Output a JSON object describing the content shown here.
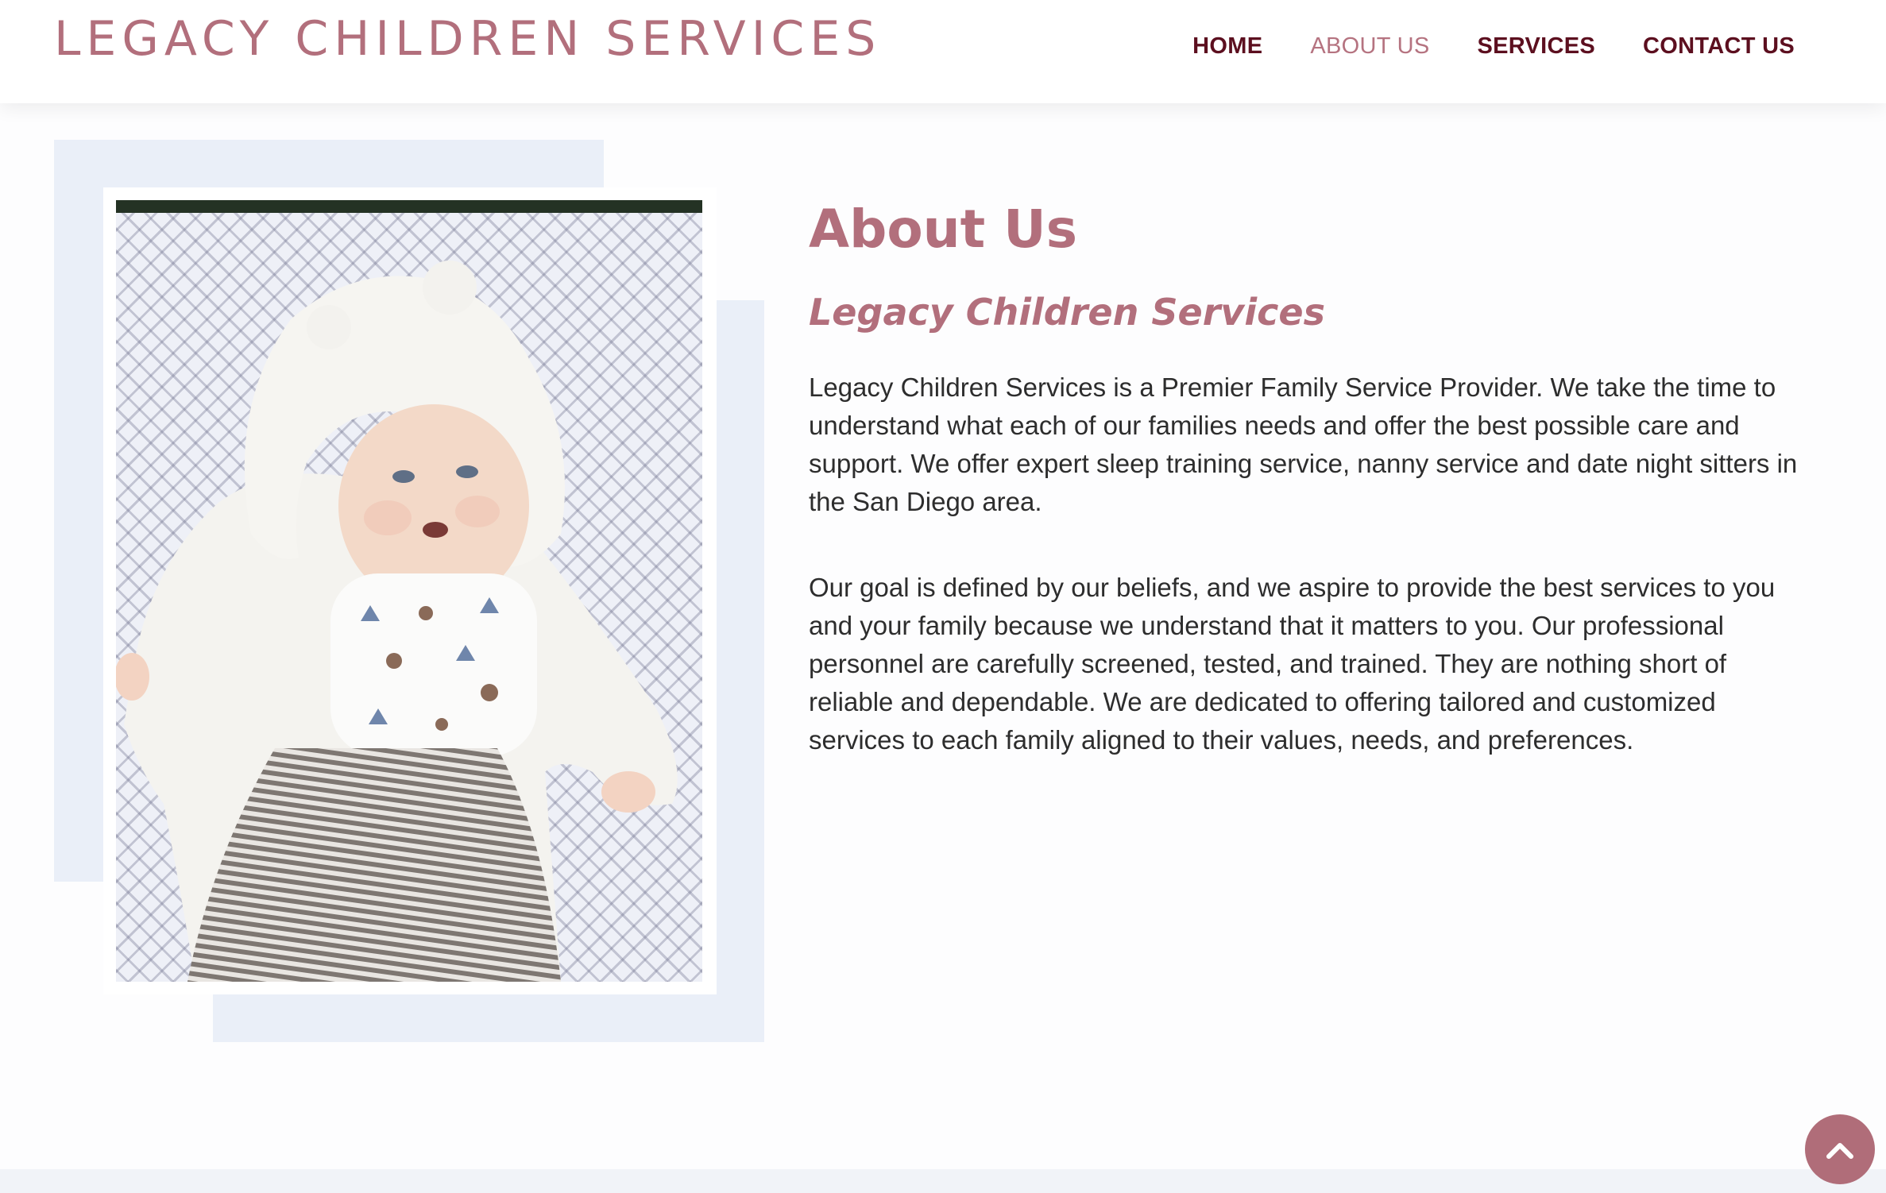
{
  "header": {
    "site_title": "LEGACY CHILDREN SERVICES",
    "nav": [
      {
        "label": "HOME",
        "active": false
      },
      {
        "label": "ABOUT US",
        "active": true
      },
      {
        "label": "SERVICES",
        "active": false
      },
      {
        "label": "CONTACT US",
        "active": false
      }
    ]
  },
  "main": {
    "heading": "About Us",
    "subheading": "Legacy Children Services",
    "paragraphs": [
      "Legacy Children Services is a Premier Family Service Provider. We take the time to understand what each of our families needs and offer the best possible care and support. We offer expert sleep training service, nanny service and date night sitters in the San Diego area.",
      "Our goal is defined by our beliefs, and we aspire to provide the best services to you and your family because we understand that it matters to you.  Our professional personnel are carefully screened, tested, and trained. They are nothing short of reliable and dependable. We are dedicated to offering tailored and customized services to each family aligned to their values, needs, and preferences."
    ]
  },
  "icons": {
    "scroll_top": "chevron-up-icon"
  },
  "colors": {
    "brand": "#b26f7c",
    "nav_text": "#5c0f1f",
    "nav_active": "#b57380",
    "decor_block": "#eaeff8",
    "scroll_button": "#b06d79"
  }
}
